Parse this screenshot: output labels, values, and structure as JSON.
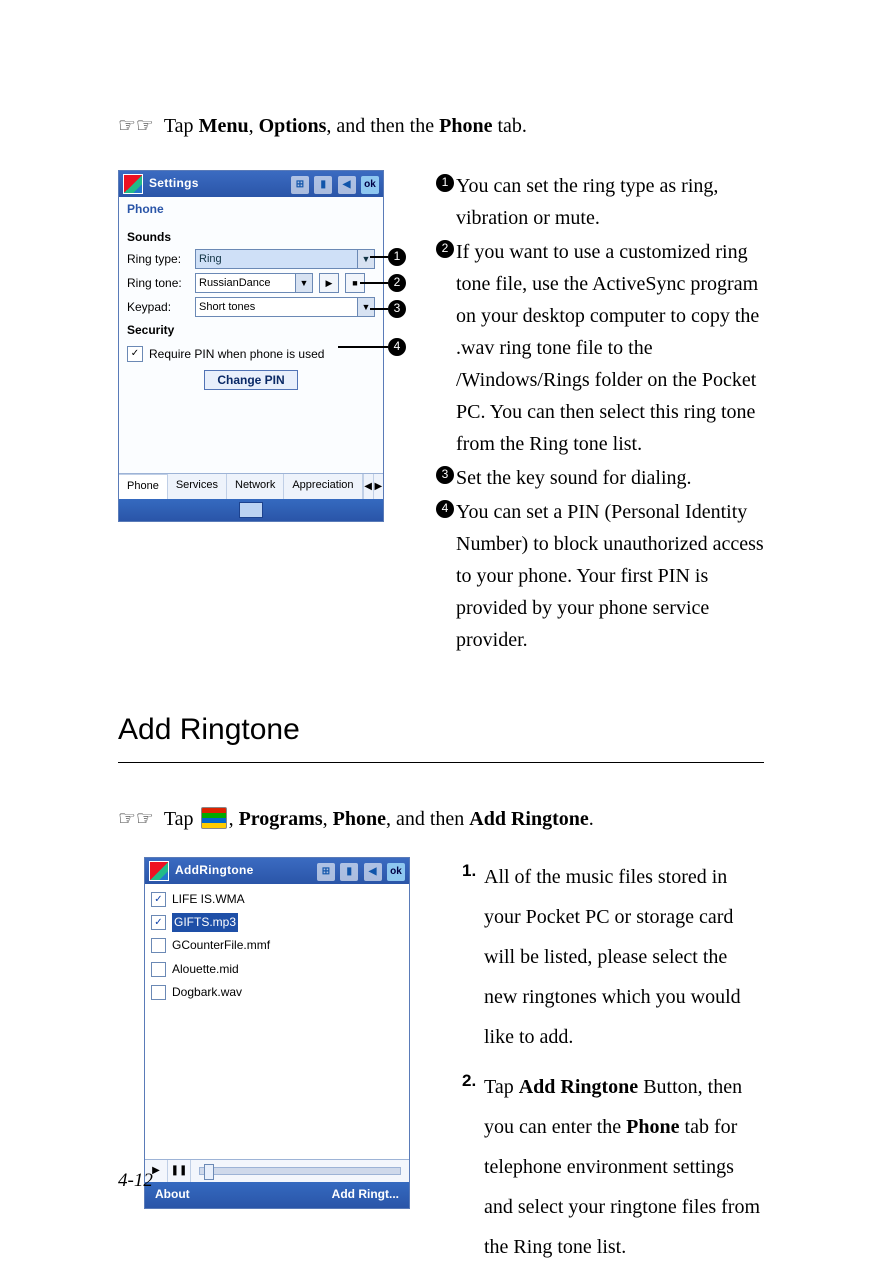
{
  "intro1_prefix": "Tap ",
  "intro1_b1": "Menu",
  "intro1_mid1": ", ",
  "intro1_b2": "Options",
  "intro1_mid2": ", and then the ",
  "intro1_b3": "Phone",
  "intro1_suffix": " tab.",
  "shot1": {
    "title": "Settings",
    "ok": "ok",
    "sub": "Phone",
    "sounds": "Sounds",
    "ringtype_lbl": "Ring type:",
    "ringtype_val": "Ring",
    "ringtone_lbl": "Ring tone:",
    "ringtone_val": "RussianDance",
    "keypad_lbl": "Keypad:",
    "keypad_val": "Short tones",
    "security": "Security",
    "req_pin": "Require PIN when phone is used",
    "change_pin": "Change PIN",
    "tabs": [
      "Phone",
      "Services",
      "Network",
      "Appreciation"
    ]
  },
  "callouts": {
    "c1": "1",
    "c2": "2",
    "c3": "3",
    "c4": "4"
  },
  "desc": {
    "d1": "You can set the ring type as ring, vibration or mute.",
    "d2": "If you want to use a customized ring tone file, use the ActiveSync program on your desktop computer to copy the .wav ring tone file to the /Windows/Rings folder on the Pocket PC. You can then select this ring tone from the Ring tone list.",
    "d3": "Set the key sound for dialing.",
    "d4": "You can set a PIN (Personal Identity Number) to block unauthorized access to your phone. Your first PIN is provided by your phone service provider."
  },
  "heading": "Add Ringtone",
  "intro2_prefix": "Tap  ",
  "intro2_mid1": ", ",
  "intro2_b1": "Programs",
  "intro2_mid2": ", ",
  "intro2_b2": "Phone",
  "intro2_mid3": ", and then ",
  "intro2_b3": "Add Ringtone",
  "intro2_suffix": ".",
  "shot2": {
    "title": "AddRingtone",
    "ok": "ok",
    "files": [
      {
        "name": "LIFE IS.WMA",
        "checked": true,
        "selected": false
      },
      {
        "name": "GIFTS.mp3",
        "checked": true,
        "selected": true
      },
      {
        "name": "GCounterFile.mmf",
        "checked": false,
        "selected": false
      },
      {
        "name": "Alouette.mid",
        "checked": false,
        "selected": false
      },
      {
        "name": "Dogbark.wav",
        "checked": false,
        "selected": false
      }
    ],
    "soft_left": "About",
    "soft_right": "Add Ringt..."
  },
  "steps": {
    "n1": "1.",
    "n2": "2.",
    "s1": "All of the music files stored in your Pocket PC or storage card will be listed, please select the new ringtones which you would like to add.",
    "s2a": "Tap ",
    "s2b1": "Add Ringtone",
    "s2b": " Button, then you can enter the ",
    "s2b2": "Phone",
    "s2c": " tab for telephone environment settings and select your ringtone files from the Ring tone list."
  },
  "page_num": "4-12"
}
